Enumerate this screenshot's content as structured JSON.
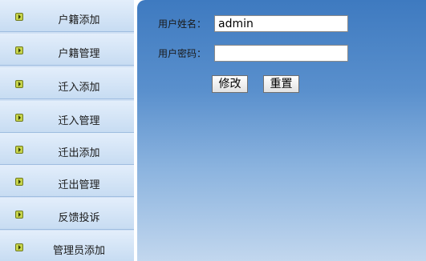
{
  "sidebar": {
    "items": [
      {
        "label": "户籍添加",
        "icon": "arrow-icon"
      },
      {
        "label": "户籍管理",
        "icon": "arrow-icon"
      },
      {
        "label": "迁入添加",
        "icon": "arrow-icon"
      },
      {
        "label": "迁入管理",
        "icon": "arrow-icon"
      },
      {
        "label": "迁出添加",
        "icon": "arrow-icon"
      },
      {
        "label": "迁出管理",
        "icon": "arrow-icon"
      },
      {
        "label": "反馈投诉",
        "icon": "arrow-icon"
      },
      {
        "label": "管理员添加",
        "icon": "arrow-icon"
      }
    ]
  },
  "form": {
    "username_label": "用户姓名：",
    "username_value": "admin",
    "password_label": "用户密码：",
    "password_value": "",
    "modify_label": "修改",
    "reset_label": "重置"
  },
  "colors": {
    "sidebar_bg": "#cfe0f4",
    "main_top": "#3e7ac0",
    "main_bottom": "#c2d7ee",
    "icon_fill": "#c6d34a"
  }
}
